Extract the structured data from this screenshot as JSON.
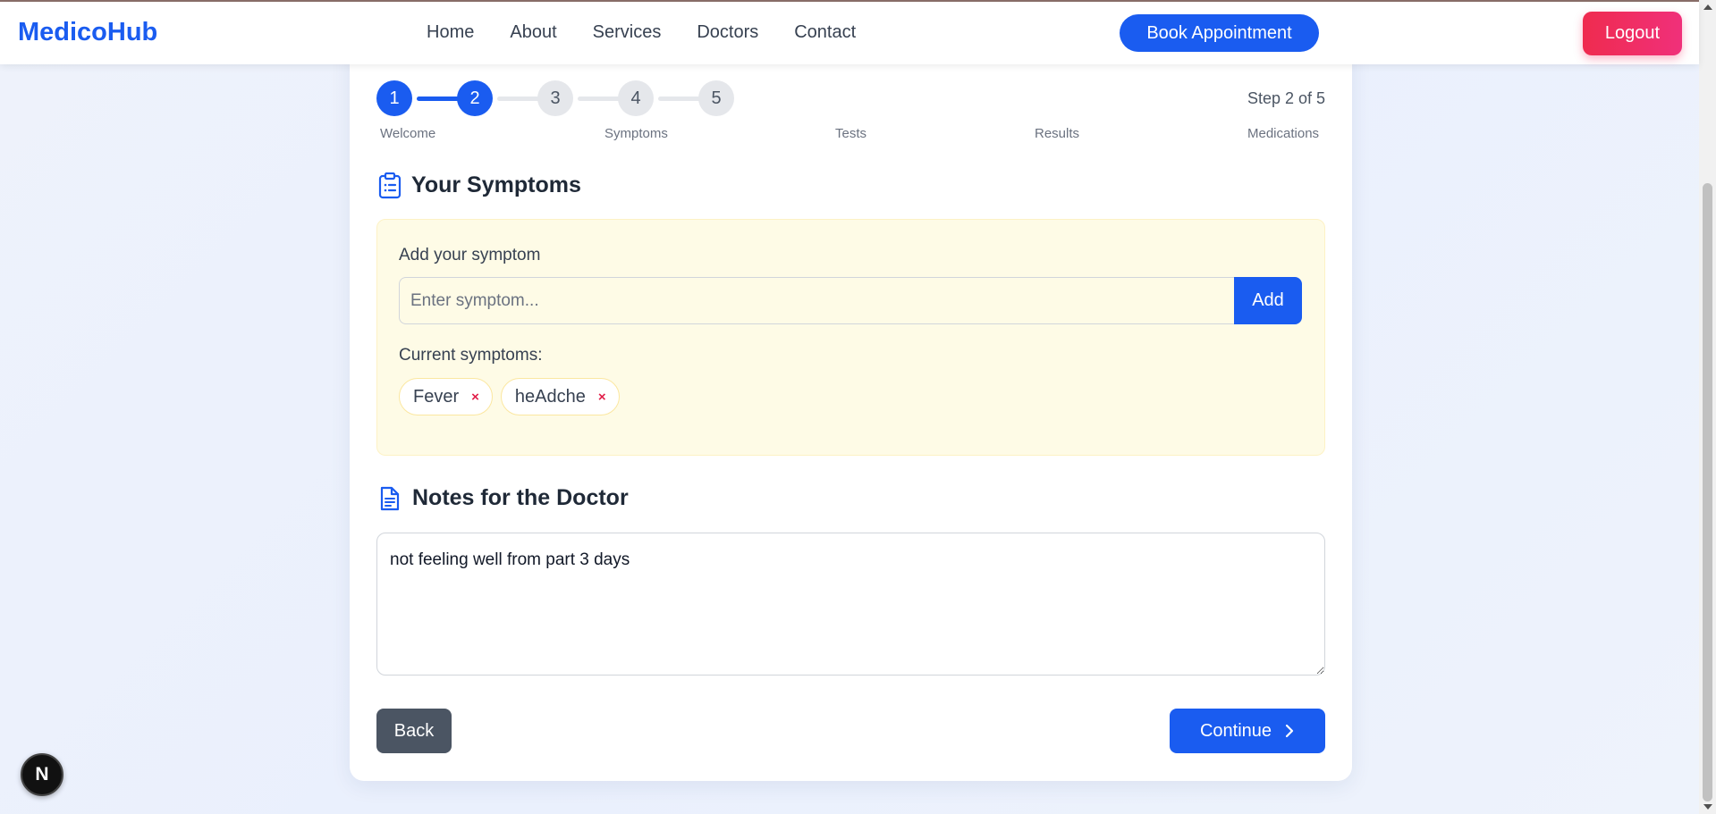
{
  "nav": {
    "brand": "MedicoHub",
    "links": [
      "Home",
      "About",
      "Services",
      "Doctors",
      "Contact"
    ],
    "book_label": "Book Appointment",
    "logout_label": "Logout"
  },
  "stepper": {
    "steps": [
      "1",
      "2",
      "3",
      "4",
      "5"
    ],
    "current_step": 2,
    "labels": [
      "Welcome",
      "Symptoms",
      "Tests",
      "Results",
      "Medications"
    ],
    "progress_text": "Step 2 of 5"
  },
  "symptoms": {
    "title": "Your Symptoms",
    "icon": "clipboard-list-icon",
    "add_label": "Add your symptom",
    "input_placeholder": "Enter symptom...",
    "input_value": "",
    "add_button": "Add",
    "current_label": "Current symptoms:",
    "items": [
      "Fever",
      "heAdche"
    ],
    "remove_glyph": "×"
  },
  "notes": {
    "title": "Notes for the Doctor",
    "icon": "document-icon",
    "value": "not feeling well from part 3 days"
  },
  "actions": {
    "back": "Back",
    "continue": "Continue"
  },
  "badge": {
    "glyph": "N"
  },
  "colors": {
    "primary": "#1a5cf0",
    "logout": "#ef2b4f",
    "symptom_bg": "#fefbe6",
    "back": "#4b5563"
  }
}
